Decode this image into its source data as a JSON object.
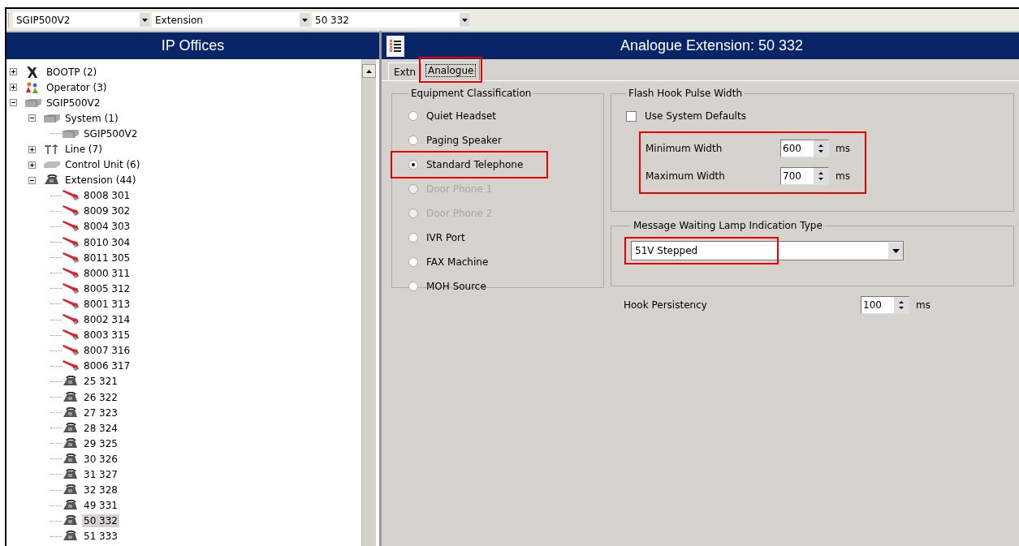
{
  "toolbar": {
    "combos": [
      {
        "value": "SGIP500V2"
      },
      {
        "value": "Extension"
      },
      {
        "value": "50 332"
      }
    ]
  },
  "left_panel": {
    "title": "IP Offices",
    "tree": [
      {
        "label": "BOOTP (2)",
        "kind": "bootp",
        "expanded": false,
        "selected": false
      },
      {
        "label": "Operator (3)",
        "kind": "operator",
        "expanded": false,
        "selected": false
      },
      {
        "label": "SGIP500V2",
        "kind": "unit",
        "expanded": true,
        "selected": false,
        "children": [
          {
            "label": "System (1)",
            "kind": "unit",
            "expanded": true,
            "selected": false,
            "children": [
              {
                "label": "SGIP500V2",
                "kind": "unit",
                "selected": false
              }
            ]
          },
          {
            "label": "Line (7)",
            "kind": "line",
            "expanded": false,
            "selected": false
          },
          {
            "label": "Control Unit (6)",
            "kind": "module",
            "expanded": false,
            "selected": false
          },
          {
            "label": "Extension (44)",
            "kind": "phone",
            "expanded": true,
            "selected": false,
            "children": [
              {
                "label": "8008 301",
                "kind": "cable",
                "selected": false
              },
              {
                "label": "8009 302",
                "kind": "cable",
                "selected": false
              },
              {
                "label": "8004 303",
                "kind": "cable",
                "selected": false
              },
              {
                "label": "8010 304",
                "kind": "cable",
                "selected": false
              },
              {
                "label": "8011 305",
                "kind": "cable",
                "selected": false
              },
              {
                "label": "8000 311",
                "kind": "cable",
                "selected": false
              },
              {
                "label": "8005 312",
                "kind": "cable",
                "selected": false
              },
              {
                "label": "8001 313",
                "kind": "cable",
                "selected": false
              },
              {
                "label": "8002 314",
                "kind": "cable",
                "selected": false
              },
              {
                "label": "8003 315",
                "kind": "cable",
                "selected": false
              },
              {
                "label": "8007 316",
                "kind": "cable",
                "selected": false
              },
              {
                "label": "8006 317",
                "kind": "cable",
                "selected": false
              },
              {
                "label": "25 321",
                "kind": "phone",
                "selected": false
              },
              {
                "label": "26 322",
                "kind": "phone",
                "selected": false
              },
              {
                "label": "27 323",
                "kind": "phone",
                "selected": false
              },
              {
                "label": "28 324",
                "kind": "phone",
                "selected": false
              },
              {
                "label": "29 325",
                "kind": "phone",
                "selected": false
              },
              {
                "label": "30 326",
                "kind": "phone",
                "selected": false
              },
              {
                "label": "31 327",
                "kind": "phone",
                "selected": false
              },
              {
                "label": "32 328",
                "kind": "phone",
                "selected": false
              },
              {
                "label": "49 331",
                "kind": "phone",
                "selected": false
              },
              {
                "label": "50 332",
                "kind": "phone",
                "selected": true
              },
              {
                "label": "51 333",
                "kind": "phone",
                "selected": false
              }
            ]
          }
        ]
      }
    ]
  },
  "right_panel": {
    "title": "Analogue Extension: 50 332",
    "tabs": [
      {
        "label": "Extn",
        "selected": false,
        "highlighted": false
      },
      {
        "label": "Analogue",
        "selected": true,
        "highlighted": true
      }
    ],
    "equipment_classification": {
      "title": "Equipment Classification",
      "options": [
        {
          "label": "Quiet Headset",
          "selected": false,
          "disabled": false,
          "highlighted": false
        },
        {
          "label": "Paging Speaker",
          "selected": false,
          "disabled": false,
          "highlighted": false
        },
        {
          "label": "Standard Telephone",
          "selected": true,
          "disabled": false,
          "highlighted": true
        },
        {
          "label": "Door Phone 1",
          "selected": false,
          "disabled": true,
          "highlighted": false
        },
        {
          "label": "Door Phone 2",
          "selected": false,
          "disabled": true,
          "highlighted": false
        },
        {
          "label": "IVR Port",
          "selected": false,
          "disabled": false,
          "highlighted": false
        },
        {
          "label": "FAX Machine",
          "selected": false,
          "disabled": false,
          "highlighted": false
        },
        {
          "label": "MOH Source",
          "selected": false,
          "disabled": false,
          "highlighted": false
        }
      ]
    },
    "flash_hook": {
      "title": "Flash Hook Pulse Width",
      "use_defaults": {
        "label": "Use System Defaults",
        "checked": false
      },
      "highlighted": true,
      "fields": [
        {
          "label": "Minimum Width",
          "value": "600",
          "unit": "ms"
        },
        {
          "label": "Maximum Width",
          "value": "700",
          "unit": "ms"
        }
      ]
    },
    "message_waiting": {
      "title": "Message Waiting Lamp Indication Type",
      "value": "51V Stepped",
      "highlighted": true
    },
    "hook_persistency": {
      "label": "Hook Persistency",
      "value": "100",
      "unit": "ms"
    }
  }
}
